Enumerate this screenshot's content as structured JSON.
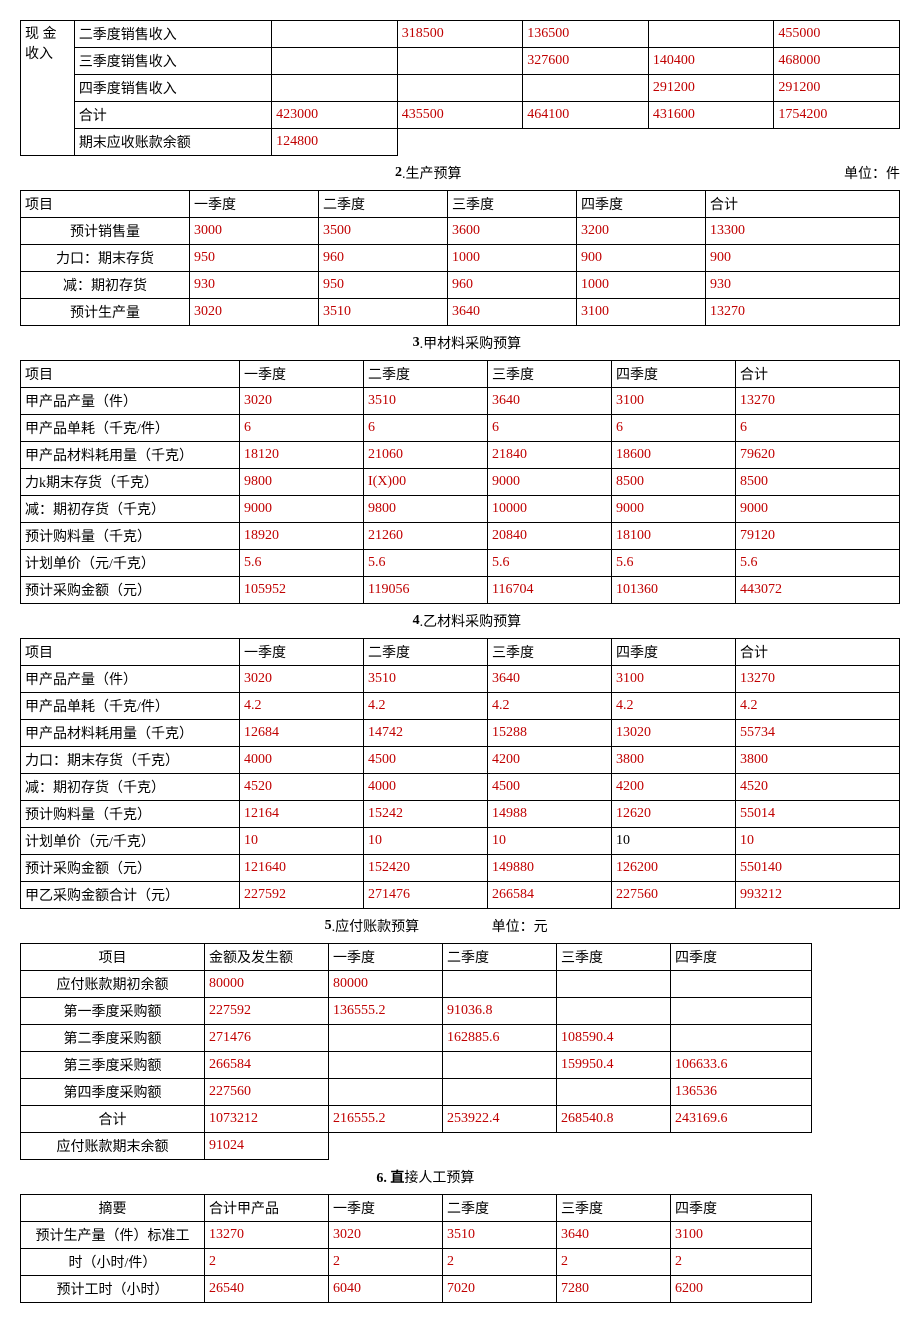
{
  "t1": {
    "side_label_1": "现 金",
    "side_label_2": "收入",
    "rows": [
      {
        "label": "二季度销售收入",
        "c1": "",
        "c2": "318500",
        "c3": "136500",
        "c4": "",
        "c5": "455000"
      },
      {
        "label": "三季度销售收入",
        "c1": "",
        "c2": "",
        "c3": "327600",
        "c4": "140400",
        "c5": "468000"
      },
      {
        "label": "四季度销售收入",
        "c1": "",
        "c2": "",
        "c3": "",
        "c4": "291200",
        "c5": "291200"
      },
      {
        "label": "合计",
        "c1": "423000",
        "c2": "435500",
        "c3": "464100",
        "c4": "431600",
        "c5": "1754200"
      },
      {
        "label": "期末应收账款余额",
        "c1": "124800",
        "c2": "",
        "c3": "",
        "c4": "",
        "c5": ""
      }
    ]
  },
  "t2": {
    "title_num": "2",
    "title_text": ".生产预算",
    "unit": "单位：件",
    "headers": [
      "项目",
      "一季度",
      "二季度",
      "三季度",
      "四季度",
      "合计"
    ],
    "rows": [
      {
        "l": "预计销售量",
        "v": [
          "3000",
          "3500",
          "3600",
          "3200",
          "13300"
        ]
      },
      {
        "l": "力口：期末存货",
        "v": [
          "950",
          "960",
          "1000",
          "900",
          "900"
        ]
      },
      {
        "l": "减：期初存货",
        "v": [
          "930",
          "950",
          "960",
          "1000",
          "930"
        ]
      },
      {
        "l": "预计生产量",
        "v": [
          "3020",
          "3510",
          "3640",
          "3100",
          "13270"
        ]
      }
    ]
  },
  "t3": {
    "title_num": "3",
    "title_text": ".甲材料采购预算",
    "headers": [
      "项目",
      "一季度",
      "二季度",
      "三季度",
      "四季度",
      "合计"
    ],
    "rows": [
      {
        "l": "甲产品产量（件）",
        "v": [
          "3020",
          "3510",
          "3640",
          "3100",
          "13270"
        ]
      },
      {
        "l": "甲产品单耗（千克/件）",
        "v": [
          "6",
          "6",
          "6",
          "6",
          "6"
        ]
      },
      {
        "l": "甲产品材料耗用量（千克）",
        "v": [
          "18120",
          "21060",
          "21840",
          "18600",
          "79620"
        ]
      },
      {
        "l": "力k期末存货（千克）",
        "v": [
          "9800",
          "I(X)00",
          "9000",
          "8500",
          "8500"
        ]
      },
      {
        "l": "减：期初存货（千克）",
        "v": [
          "9000",
          "9800",
          "10000",
          "9000",
          "9000"
        ]
      },
      {
        "l": "预计购料量（千克）",
        "v": [
          "18920",
          "21260",
          "20840",
          "18100",
          "79120"
        ]
      },
      {
        "l": "计划单价（元/千克）",
        "v": [
          "5.6",
          "5.6",
          "5.6",
          "5.6",
          "5.6"
        ]
      },
      {
        "l": "预计采购金额（元）",
        "v": [
          "105952",
          "119056",
          "116704",
          "101360",
          "443072"
        ]
      }
    ]
  },
  "t4": {
    "title_num": "4",
    "title_text": ".乙材料采购预算",
    "headers": [
      "项目",
      "一季度",
      "二季度",
      "三季度",
      "四季度",
      "合计"
    ],
    "rows": [
      {
        "l": "甲产品产量（件）",
        "v": [
          "3020",
          "3510",
          "3640",
          "3100",
          "13270"
        ]
      },
      {
        "l": "甲产品单耗（千克/件）",
        "v": [
          "4.2",
          "4.2",
          "4.2",
          "4.2",
          "4.2"
        ]
      },
      {
        "l": "甲产品材料耗用量（千克）",
        "v": [
          "12684",
          "14742",
          "15288",
          "13020",
          "55734"
        ]
      },
      {
        "l": "力口：期末存货（千克）",
        "v": [
          "4000",
          "4500",
          "4200",
          "3800",
          "3800"
        ]
      },
      {
        "l": "减：期初存货（千克）",
        "v": [
          "4520",
          "4000",
          "4500",
          "4200",
          "4520"
        ]
      },
      {
        "l": "预计购料量（千克）",
        "v": [
          "12164",
          "15242",
          "14988",
          "12620",
          "55014"
        ]
      },
      {
        "l": "计划单价（元/千克）",
        "v": [
          "10",
          "10",
          "10",
          "10",
          "10"
        ]
      },
      {
        "l": "预计采购金额（元）",
        "v": [
          "121640",
          "152420",
          "149880",
          "126200",
          "550140"
        ]
      },
      {
        "l": "甲乙采购金额合计（元）",
        "v": [
          "227592",
          "271476",
          "266584",
          "227560",
          "993212"
        ]
      }
    ]
  },
  "t5": {
    "title_num": "5",
    "title_text": ".应付账款预算",
    "unit": "单位：元",
    "headers": [
      "项目",
      "金额及发生额",
      "一季度",
      "二季度",
      "三季度",
      "四季度"
    ],
    "rows": [
      {
        "l": "应付账款期初余额",
        "v": [
          "80000",
          "80000",
          "",
          "",
          ""
        ]
      },
      {
        "l": "第一季度采购额",
        "v": [
          "227592",
          "136555.2",
          "91036.8",
          "",
          ""
        ]
      },
      {
        "l": "第二季度采购额",
        "v": [
          "271476",
          "",
          "162885.6",
          "108590.4",
          ""
        ]
      },
      {
        "l": "第三季度采购额",
        "v": [
          "266584",
          "",
          "",
          "159950.4",
          "106633.6"
        ]
      },
      {
        "l": "第四季度采购额",
        "v": [
          "227560",
          "",
          "",
          "",
          "136536"
        ]
      },
      {
        "l": "合计",
        "v": [
          "1073212",
          "216555.2",
          "253922.4",
          "268540.8",
          "243169.6"
        ]
      },
      {
        "l": "应付账款期末余额",
        "v": [
          "91024",
          "",
          "",
          "",
          ""
        ]
      }
    ]
  },
  "t6": {
    "title_num": "6",
    "title_text_1": ". 直",
    "title_text_2": "接人工预算",
    "headers": [
      "摘要",
      "合计甲产品",
      "一季度",
      "二季度",
      "三季度",
      "四季度"
    ],
    "rows": [
      {
        "l": "预计生产量（件）标准工",
        "v": [
          "13270",
          "3020",
          "3510",
          "3640",
          "3100"
        ]
      },
      {
        "l": "时（小时/件）",
        "v": [
          "2",
          "2",
          "2",
          "2",
          "2"
        ]
      },
      {
        "l": "预计工时（小时）",
        "v": [
          "26540",
          "6040",
          "7020",
          "7280",
          "6200"
        ]
      }
    ]
  }
}
